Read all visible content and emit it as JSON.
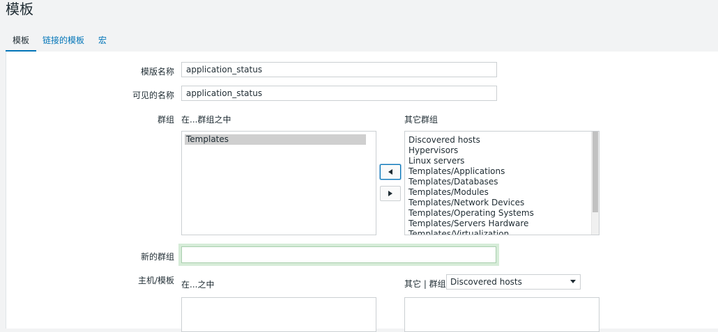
{
  "page": {
    "title": "模板"
  },
  "tabs": [
    {
      "label": "模板"
    },
    {
      "label": "链接的模板"
    },
    {
      "label": "宏"
    }
  ],
  "form": {
    "template_name": {
      "label": "模版名称",
      "value": "application_status"
    },
    "visible_name": {
      "label": "可见的名称",
      "value": "application_status"
    },
    "groups": {
      "label": "群组",
      "in_groups_label": "在...群组之中",
      "other_groups_label": "其它群组",
      "in_groups": [
        "Templates"
      ],
      "other_groups": [
        "Discovered hosts",
        "Hypervisors",
        "Linux servers",
        "Templates/Applications",
        "Templates/Databases",
        "Templates/Modules",
        "Templates/Network Devices",
        "Templates/Operating Systems",
        "Templates/Servers Hardware",
        "Templates/Virtualization"
      ]
    },
    "new_group": {
      "label": "新的群组",
      "value": ""
    },
    "hosts": {
      "label": "主机/模板",
      "in_label": "在...之中",
      "other_label": "其它 | 群组",
      "group_select": "Discovered hosts"
    }
  }
}
